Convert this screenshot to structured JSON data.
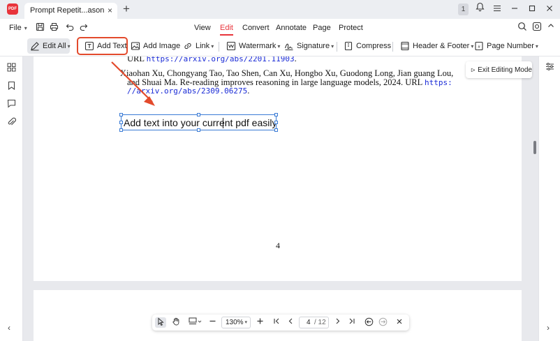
{
  "titlebar": {
    "app_logo_text": "PDF",
    "tab_title": "Prompt Repetit...asoning LLMs *",
    "tab_close": "×",
    "new_tab": "+",
    "notification_count": "1",
    "icons": [
      "bell-icon",
      "hamburger-menu-icon",
      "minimize-icon",
      "maximize-icon",
      "close-window-icon"
    ]
  },
  "menubar": {
    "file_label": "File",
    "tabs": [
      {
        "label": "View"
      },
      {
        "label": "Edit",
        "active": true
      },
      {
        "label": "Convert"
      },
      {
        "label": "Annotate"
      },
      {
        "label": "Page"
      },
      {
        "label": "Protect"
      }
    ]
  },
  "toolbar": {
    "edit_all": "Edit All",
    "add_text": "Add Text",
    "add_image": "Add Image",
    "link": "Link",
    "watermark": "Watermark",
    "signature": "Signature",
    "compress": "Compress",
    "header_footer": "Header & Footer",
    "page_number": "Page Number"
  },
  "document": {
    "line1_prefix": "URL ",
    "line1_url": "https://arxiv.org/abs/2201.11903",
    "line1_suffix": ".",
    "ref2_line1": "Xiaohan Xu, Chongyang Tao, Tao Shen, Can Xu, Hongbo Xu, Guodong Long, Jian guang Lou,",
    "ref2_line2": "and Shuai Ma.  Re-reading improves reasoning in large language models, 2024.  URL ",
    "ref2_url_a": "https:",
    "ref2_url_b": "//arxiv.org/abs/2309.06275",
    "ref2_suffix": ".",
    "textbox_content": "Add text into your current pdf easily",
    "page_number": "4"
  },
  "exit_editing": "Exit Editing Mode",
  "zoombar": {
    "zoom": "130%",
    "current_page": "4",
    "total_pages": "/ 12"
  },
  "colors": {
    "accent": "#e8343b",
    "highlight_box": "#e34a2c",
    "selection": "#3a7bd5",
    "link": "#1a2bd6"
  }
}
